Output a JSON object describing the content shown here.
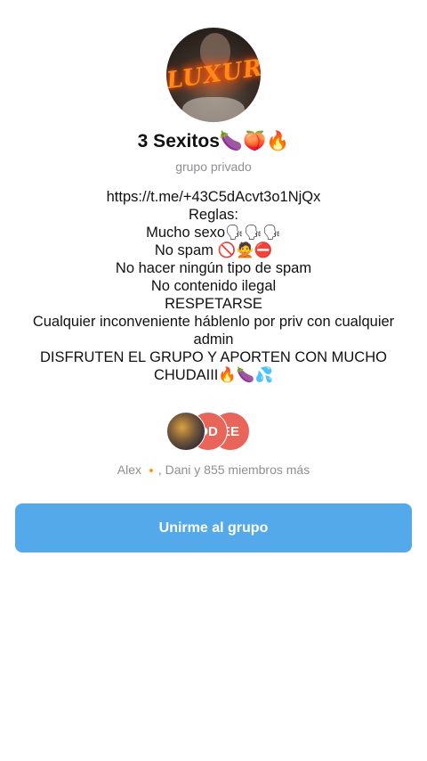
{
  "group": {
    "title": "3 Sexitos🍆🍑🔥",
    "type_label": "grupo privado",
    "avatar_logo_text": "LUXURY"
  },
  "description": {
    "lines": [
      "https://t.me/+43C5dAcvt3o1NjQx",
      "Reglas:",
      "Mucho sexo🗣🗣🗣",
      "No spam 🚫🙅⛔",
      "No hacer ningún tipo de spam",
      "No contenido ilegal",
      "RESPETARSE",
      "Cualquier inconveniente háblenlo por priv con cualquier admin",
      "DISFRUTEN EL GRUPO Y APORTEN CON MUCHO CHUDAIII🔥🍆💦"
    ]
  },
  "members": {
    "avatars": [
      {
        "initials": "",
        "kind": "photo"
      },
      {
        "initials": "DD",
        "color": "#e8655a"
      },
      {
        "initials": "EE",
        "color": "#e8655a"
      }
    ],
    "summary_prefix": "Alex",
    "summary_star": "🔸",
    "summary_suffix": ", Dani y 855 miembros más"
  },
  "actions": {
    "join_label": "Unirme al grupo"
  },
  "colors": {
    "accent": "#54a9eb",
    "muted_text": "#8e8e93",
    "member_avatar": "#e8655a"
  }
}
